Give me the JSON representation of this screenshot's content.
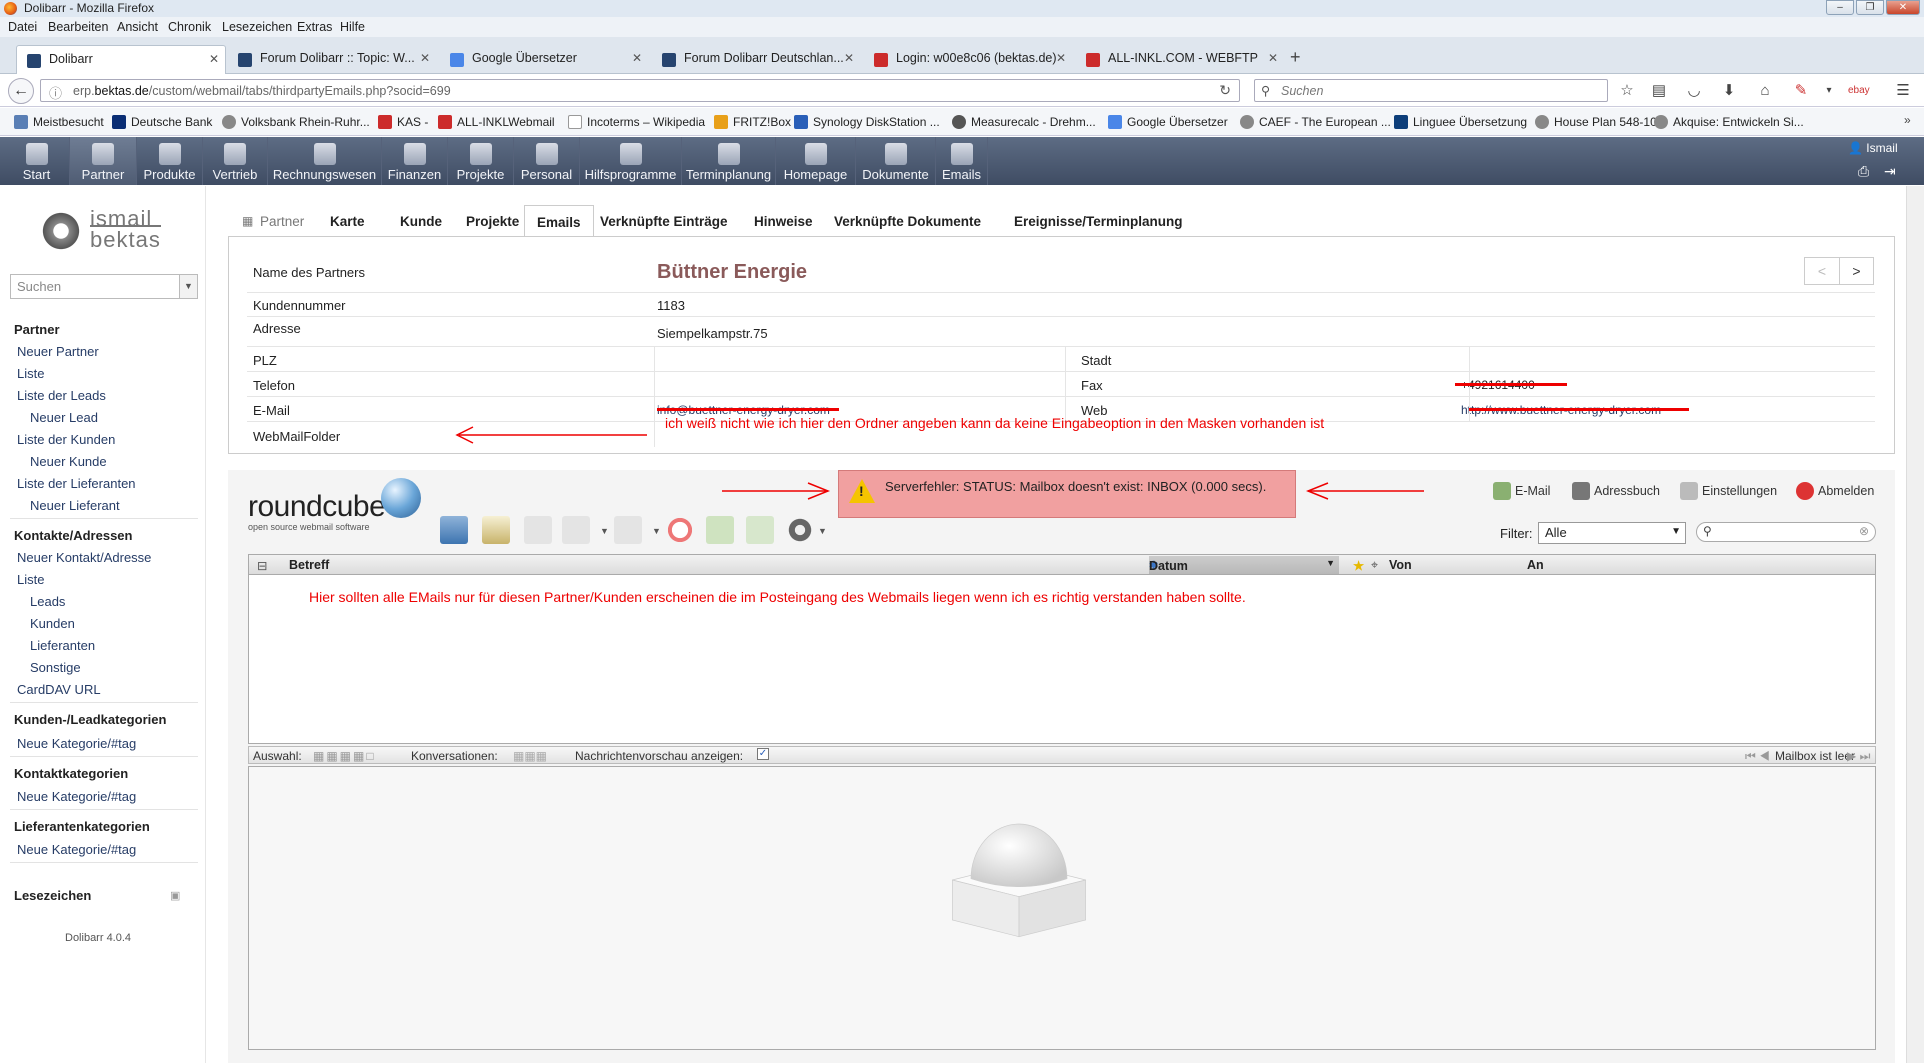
{
  "window": {
    "title": "Dolibarr - Mozilla Firefox"
  },
  "menubar": [
    "Datei",
    "Bearbeiten",
    "Ansicht",
    "Chronik",
    "Lesezeichen",
    "Extras",
    "Hilfe"
  ],
  "tabs": [
    {
      "label": "Dolibarr",
      "active": true
    },
    {
      "label": "Forum Dolibarr :: Topic: W...",
      "active": false
    },
    {
      "label": "Google Übersetzer",
      "active": false
    },
    {
      "label": "Forum Dolibarr Deutschlan...",
      "active": false
    },
    {
      "label": "Login: w00e8c06 (bektas.de)",
      "active": false
    },
    {
      "label": "ALL-INKL.COM - WEBFTP",
      "active": false
    }
  ],
  "nav": {
    "url_prefix": "erp.",
    "url_domain": "bektas.de",
    "url_path": "/custom/webmail/tabs/thirdpartyEmails.php?socid=699",
    "search_placeholder": "Suchen"
  },
  "bookmarks": [
    "Meistbesucht",
    "Deutsche Bank",
    "Volksbank Rhein-Ruhr...",
    "KAS -",
    "ALL-INKLWebmail",
    "Incoterms – Wikipedia",
    "FRITZ!Box",
    "Synology DiskStation ...",
    "Measurecalc - Drehm...",
    "Google Übersetzer",
    "CAEF - The European ...",
    "Linguee Übersetzung",
    "House Plan 548-10",
    "Akquise: Entwickeln Si..."
  ],
  "dolimenu": [
    "Start",
    "Partner",
    "Produkte",
    "Vertrieb",
    "Rechnungswesen",
    "Finanzen",
    "Projekte",
    "Personal",
    "Hilfsprogramme",
    "Terminplanung",
    "Homepage",
    "Dokumente",
    "Emails"
  ],
  "user": {
    "name": "Ismail"
  },
  "sidebar": {
    "logo_top": "ismail",
    "logo_bottom": "bektas",
    "search_placeholder": "Suchen",
    "partner_h": "Partner",
    "partner_items": [
      "Neuer Partner",
      "Liste",
      "Liste der Leads",
      "Neuer Lead",
      "Liste der Kunden",
      "Neuer Kunde",
      "Liste der Lieferanten",
      "Neuer Lieferant"
    ],
    "kontakte_h": "Kontakte/Adressen",
    "kontakte_items": [
      "Neuer Kontakt/Adresse",
      "Liste",
      "Leads",
      "Kunden",
      "Lieferanten",
      "Sonstige",
      "CardDAV URL"
    ],
    "kundenkat_h": "Kunden-/Leadkategorien",
    "kundenkat_item": "Neue Kategorie/#tag",
    "kontaktkat_h": "Kontaktkategorien",
    "kontaktkat_item": "Neue Kategorie/#tag",
    "lieferkat_h": "Lieferantenkategorien",
    "lieferkat_item": "Neue Kategorie/#tag",
    "lesezeichen_h": "Lesezeichen",
    "version": "Dolibarr 4.0.4"
  },
  "maintabs": [
    "Partner",
    "Karte",
    "Kunde",
    "Projekte",
    "Emails",
    "Verknüpfte Einträge",
    "Hinweise",
    "Verknüpfte Dokumente",
    "Ereignisse/Terminplanung"
  ],
  "partner": {
    "name_label": "Name des Partners",
    "name": "Büttner Energie",
    "kundennr_label": "Kundennummer",
    "kundennr": "1183",
    "adresse_label": "Adresse",
    "adresse": "Siempelkampstr.75",
    "plz_label": "PLZ",
    "stadt_label": "Stadt",
    "telefon_label": "Telefon",
    "fax_label": "Fax",
    "fax_value": "+4921614400",
    "email_label": "E-Mail",
    "email_value": "info@buettner-energy-dryer.com",
    "web_label": "Web",
    "web_value": "http://www.buettner-energy-dryer.com",
    "webmail_label": "WebMailFolder",
    "prev": "<",
    "next": ">"
  },
  "annotations": {
    "folder_note": "ich weiß nicht wie ich hier den Ordner angeben kann da keine Eingabeoption in den Masken vorhanden ist",
    "list_note": "Hier sollten alle EMails nur für diesen Partner/Kunden erscheinen die im Posteingang des Webmails liegen wenn ich es richtig verstanden haben sollte."
  },
  "roundcube": {
    "logo": "roundcube",
    "logo_sub": "open source webmail software",
    "error": "Serverfehler: STATUS: Mailbox doesn't exist: INBOX (0.000 secs).",
    "top_links": [
      "E-Mail",
      "Adressbuch",
      "Einstellungen",
      "Abmelden"
    ],
    "filter_label": "Filter:",
    "filter_value": "Alle",
    "columns": [
      "Betreff",
      "Datum",
      "Von",
      "An"
    ],
    "footer_auswahl": "Auswahl:",
    "footer_konv": "Konversationen:",
    "footer_preview": "Nachrichtenvorschau anzeigen:",
    "footer_status": "Mailbox ist leer"
  }
}
